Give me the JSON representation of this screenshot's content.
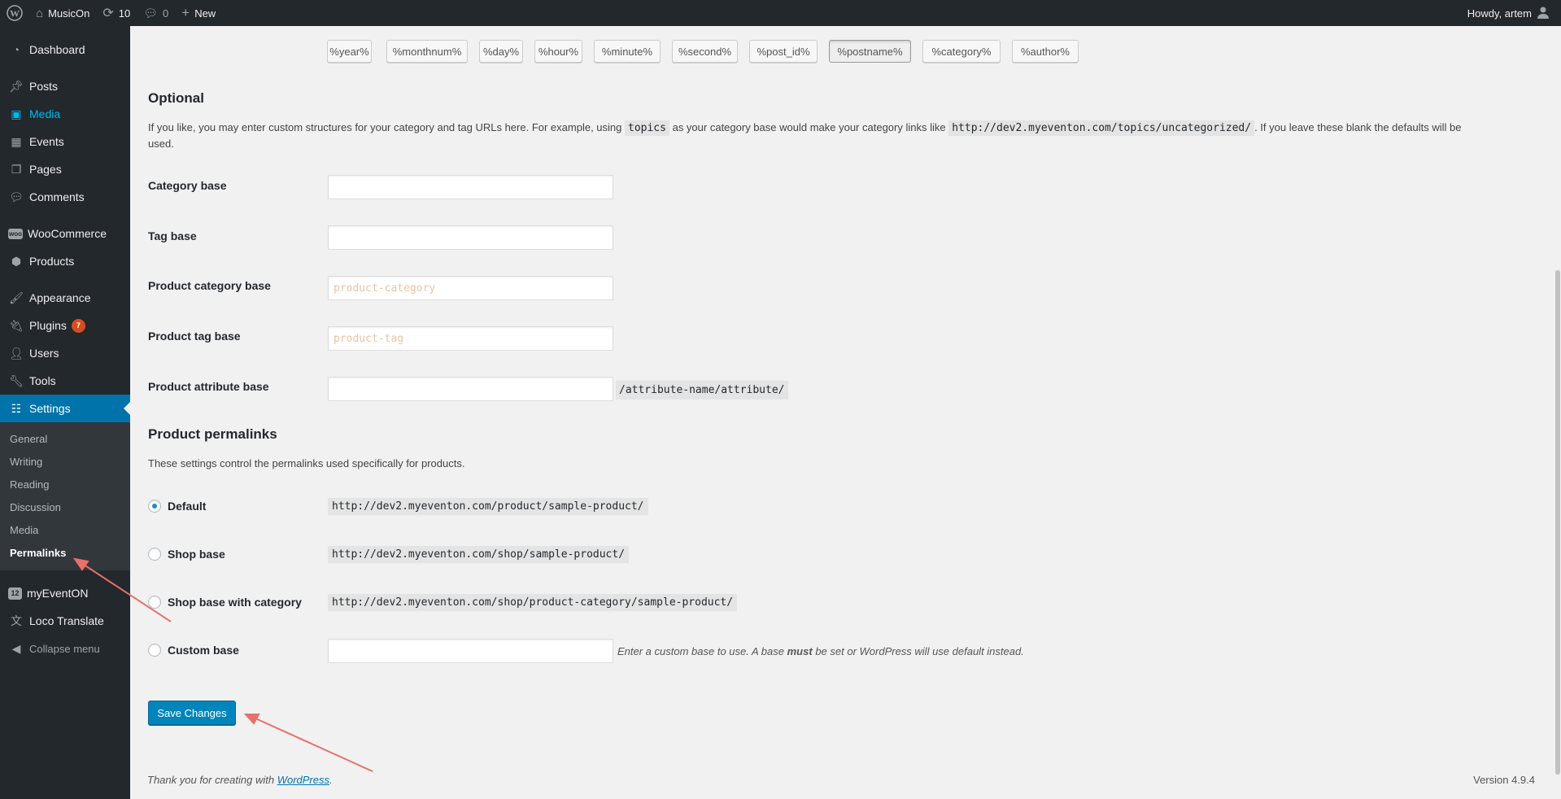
{
  "adminbar": {
    "site_name": "MusicOn",
    "updates_count": "10",
    "comments_count": "0",
    "new_label": "New",
    "howdy": "Howdy, artem"
  },
  "sidebar": {
    "dashboard": "Dashboard",
    "posts": "Posts",
    "media": "Media",
    "events": "Events",
    "pages": "Pages",
    "comments": "Comments",
    "woocommerce": "WooCommerce",
    "products": "Products",
    "appearance": "Appearance",
    "plugins": "Plugins",
    "plugins_badge": "7",
    "users": "Users",
    "tools": "Tools",
    "settings": "Settings",
    "sub": {
      "general": "General",
      "writing": "Writing",
      "reading": "Reading",
      "discussion": "Discussion",
      "media": "Media",
      "permalinks": "Permalinks"
    },
    "myeventon": "myEventON",
    "myeventon_icon": "12",
    "loco": "Loco Translate",
    "collapse": "Collapse menu"
  },
  "tags": [
    "%year%",
    "%monthnum%",
    "%day%",
    "%hour%",
    "%minute%",
    "%second%",
    "%post_id%",
    "%postname%",
    "%category%",
    "%author%"
  ],
  "optional": {
    "title": "Optional",
    "desc_1": "If you like, you may enter custom structures for your category and tag URLs here. For example, using",
    "desc_code_1": "topics",
    "desc_2": "as your category base would make your category links like",
    "desc_code_2": "http://dev2.myeventon.com/topics/uncategorized/",
    "desc_3": ". If you leave these blank the defaults will be",
    "desc_4": "used.",
    "category_base_label": "Category base",
    "category_base_value": "",
    "tag_base_label": "Tag base",
    "tag_base_value": "",
    "product_category_base_label": "Product category base",
    "product_category_base_placeholder": "product-category",
    "product_tag_base_label": "Product tag base",
    "product_tag_base_placeholder": "product-tag",
    "product_attribute_base_label": "Product attribute base",
    "product_attribute_suffix": "/attribute-name/attribute/"
  },
  "product_permalinks": {
    "title": "Product permalinks",
    "desc": "These settings control the permalinks used specifically for products.",
    "default_label": "Default",
    "default_url": "http://dev2.myeventon.com/product/sample-product/",
    "shop_base_label": "Shop base",
    "shop_base_url": "http://dev2.myeventon.com/shop/sample-product/",
    "shop_base_cat_label": "Shop base with category",
    "shop_base_cat_url": "http://dev2.myeventon.com/shop/product-category/sample-product/",
    "custom_base_label": "Custom base",
    "custom_hint_1": "Enter a custom base to use. A base",
    "custom_hint_bold": "must",
    "custom_hint_2": "be set or WordPress will use default instead."
  },
  "save_label": "Save Changes",
  "footer": {
    "thanks": "Thank you for creating with",
    "wp_link": "WordPress",
    "period": ".",
    "version": "Version 4.9.4"
  },
  "colors": {
    "adminbar_bg": "#23282d",
    "accent": "#0073aa",
    "arrow": "#e8706a"
  }
}
